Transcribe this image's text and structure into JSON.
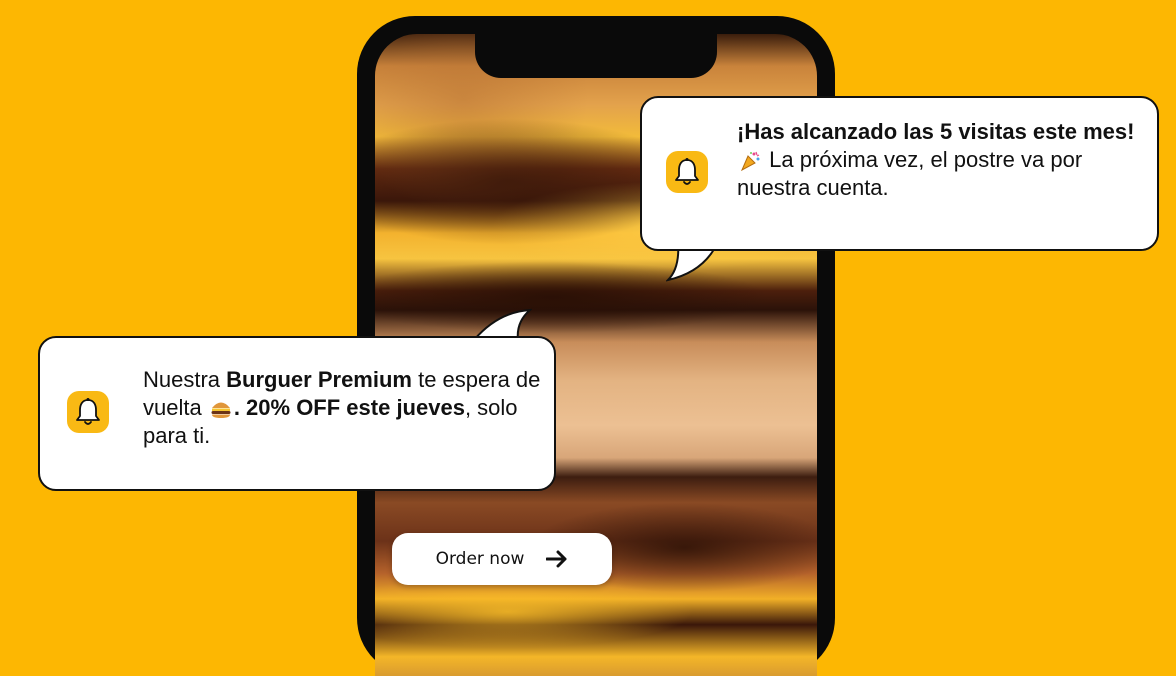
{
  "colors": {
    "background": "#FDB702",
    "bell": "#F9B914",
    "bubble": "#ffffff",
    "phone": "#0a0a0a"
  },
  "notification_top": {
    "icon": "bell-icon",
    "bold_text": "¡Has alcanzado las 5 visitas este mes!",
    "emoji": "party-popper",
    "text": " La próxima vez, el postre va por nuestra cuenta."
  },
  "notification_bottom": {
    "icon": "bell-icon",
    "text_1": "Nuestra ",
    "bold_1": "Burguer Premium",
    "text_2": " te espera de vuelta ",
    "emoji": "hamburger",
    "bold_2": ". 20% OFF este jueves",
    "text_3": ", solo para ti."
  },
  "order_button": {
    "label": "Order now",
    "icon": "arrow-right-icon"
  }
}
